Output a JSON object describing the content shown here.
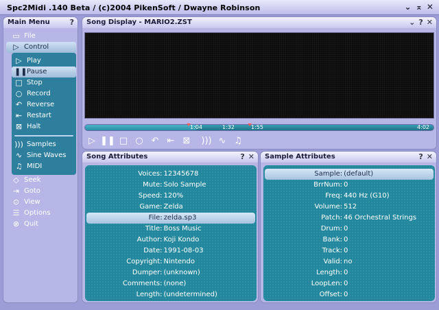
{
  "window": {
    "title": "Spc2Midi .140 Beta  /  (c)2004 PikenSoft  /  Dwayne Robinson",
    "buttons": {
      "minimize": "⌄",
      "restore": "⌅",
      "close": "✕"
    }
  },
  "panel_buttons": {
    "help": "?",
    "close": "✕",
    "expand": "⌄"
  },
  "main_menu": {
    "title": "Main Menu",
    "items": [
      {
        "label": "File",
        "icon": "file-icon"
      },
      {
        "label": "Control",
        "icon": "play-icon",
        "selected": true
      },
      {
        "label": "Seek",
        "icon": "seek-icon"
      },
      {
        "label": "Goto",
        "icon": "goto-icon"
      },
      {
        "label": "View",
        "icon": "view-icon"
      },
      {
        "label": "Options",
        "icon": "options-icon"
      },
      {
        "label": "Quit",
        "icon": "quit-icon"
      }
    ],
    "control_sub": [
      {
        "label": "Play",
        "icon": "play-icon"
      },
      {
        "label": "Pause",
        "icon": "pause-icon",
        "selected": true
      },
      {
        "label": "Stop",
        "icon": "stop-icon"
      },
      {
        "label": "Record",
        "icon": "record-icon"
      },
      {
        "label": "Reverse",
        "icon": "reverse-icon"
      },
      {
        "label": "Restart",
        "icon": "restart-icon"
      },
      {
        "label": "Halt",
        "icon": "halt-icon"
      }
    ],
    "control_sub2": [
      {
        "label": "Samples",
        "icon": "samples-icon"
      },
      {
        "label": "Sine Waves",
        "icon": "sine-waves-icon"
      },
      {
        "label": "MIDI",
        "icon": "midi-icon"
      }
    ]
  },
  "song_display": {
    "title": "Song Display - MARIO2.ZST",
    "progress": {
      "fraction": 0.32,
      "marker_times": [
        "1:04",
        "1:32",
        "1:55"
      ],
      "end_time": "4:02"
    }
  },
  "song_attributes": {
    "title": "Song Attributes",
    "rows": [
      {
        "key": "Voices:",
        "value": "12345678"
      },
      {
        "key": "Mute:",
        "value": "Solo Sample"
      },
      {
        "key": "Speed:",
        "value": "120%"
      },
      {
        "key": "Game:",
        "value": "Zelda"
      },
      {
        "key": "File:",
        "value": "zelda.sp3",
        "selected": true
      },
      {
        "key": "Title:",
        "value": "Boss Music"
      },
      {
        "key": "Author:",
        "value": "Koji Kondo"
      },
      {
        "key": "Date:",
        "value": "1991-08-03"
      },
      {
        "key": "Copyright:",
        "value": "Nintendo"
      },
      {
        "key": "Dumper:",
        "value": "(unknown)"
      },
      {
        "key": "Comments:",
        "value": "(none)"
      },
      {
        "key": "Length:",
        "value": "(undetermined)"
      }
    ]
  },
  "sample_attributes": {
    "title": "Sample Attributes",
    "rows": [
      {
        "key": "Sample:",
        "value": "(default)",
        "selected": true
      },
      {
        "key": "BrrNum:",
        "value": "0"
      },
      {
        "key": "Freq:",
        "value": "440 Hz (G10)"
      },
      {
        "key": "Volume:",
        "value": "512"
      },
      {
        "key": "Patch:",
        "value": "46 Orchestral Strings"
      },
      {
        "key": "Drum:",
        "value": "0"
      },
      {
        "key": "Bank:",
        "value": "0"
      },
      {
        "key": "Track:",
        "value": "0"
      },
      {
        "key": "Valid:",
        "value": "no"
      },
      {
        "key": "Length:",
        "value": "0"
      },
      {
        "key": "LoopLen:",
        "value": "0"
      },
      {
        "key": "Offset:",
        "value": "0"
      }
    ]
  },
  "colors": {
    "panel": "#b7b7e7",
    "teal": "#23889d",
    "background": "#9c9cd6"
  }
}
